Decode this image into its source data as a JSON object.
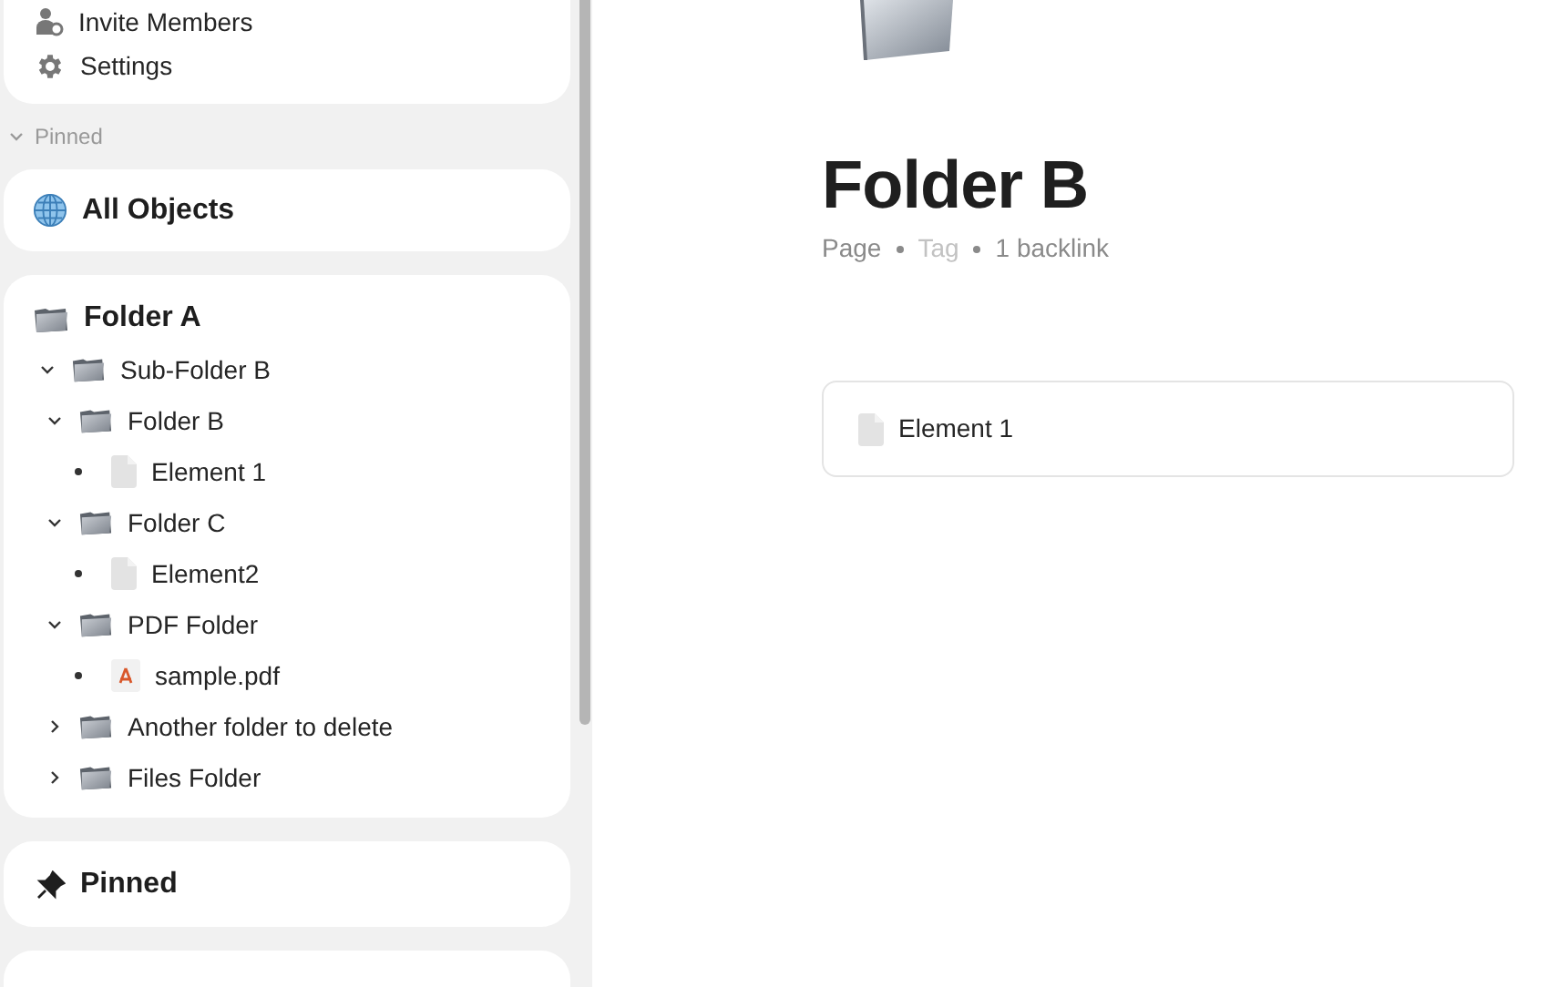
{
  "sidebar": {
    "menu_items": [
      {
        "label": "Invite Members",
        "kind": "members"
      },
      {
        "label": "Settings",
        "kind": "settings"
      }
    ],
    "pinned_header": {
      "label": "Pinned",
      "expanded": true
    },
    "all_objects": {
      "label": "All Objects"
    },
    "tree": {
      "label": "Folder A",
      "children": [
        {
          "label": "Sub-Folder B",
          "kind": "folder",
          "expanded": true,
          "children": [
            {
              "label": "Folder B",
              "kind": "folder",
              "expanded": true,
              "children": [
                {
                  "label": "Element 1",
                  "kind": "page"
                }
              ]
            },
            {
              "label": "Folder C",
              "kind": "folder",
              "expanded": true,
              "children": [
                {
                  "label": "Element2",
                  "kind": "page"
                }
              ]
            },
            {
              "label": "PDF Folder",
              "kind": "folder",
              "expanded": true,
              "children": [
                {
                  "label": "sample.pdf",
                  "kind": "pdf"
                }
              ]
            },
            {
              "label": "Another folder to delete",
              "kind": "folder",
              "expanded": false
            },
            {
              "label": "Files Folder",
              "kind": "folder",
              "expanded": false
            }
          ]
        }
      ]
    },
    "pinned_card": {
      "label": "Pinned"
    }
  },
  "page": {
    "title": "Folder B",
    "meta": [
      {
        "label": "Page",
        "kind": "type"
      },
      {
        "label": "Tag",
        "kind": "placeholder"
      },
      {
        "label": "1 backlink",
        "kind": "backlinks"
      }
    ],
    "items": [
      {
        "label": "Element 1",
        "kind": "page"
      }
    ]
  }
}
